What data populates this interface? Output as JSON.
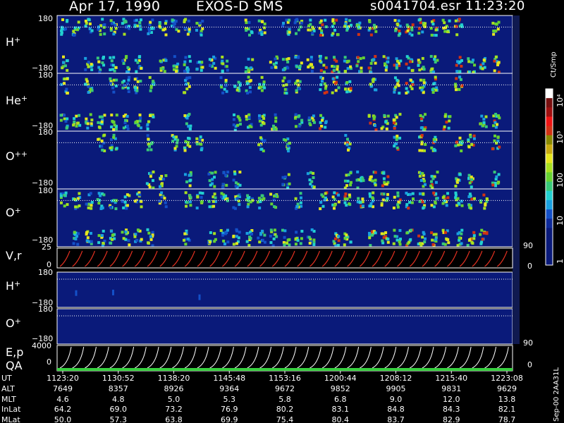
{
  "header": {
    "date": "Apr 17, 1990",
    "instrument": "EXOS-D SMS",
    "filename": "s0041704.esr",
    "time": "11:23:20"
  },
  "panels": [
    {
      "key": "h",
      "label": "H",
      "sup": "+",
      "ymax": "180",
      "ymin": "−180"
    },
    {
      "key": "he",
      "label": "He",
      "sup": "+",
      "ymax": "180",
      "ymin": "−180"
    },
    {
      "key": "opp",
      "label": "O",
      "sup": "++",
      "ymax": "180",
      "ymin": "−180"
    },
    {
      "key": "op",
      "label": "O",
      "sup": "+",
      "ymax": "180",
      "ymin": "−180"
    },
    {
      "key": "vr",
      "label": "V,r",
      "ymax": "25",
      "ymin": "0",
      "right_max": "90",
      "right_min": "0"
    },
    {
      "key": "h2",
      "label": "H",
      "sup": "+",
      "ymax": "180",
      "ymin": "−180"
    },
    {
      "key": "o2",
      "label": "O",
      "sup": "+",
      "ymax": "180",
      "ymin": "−180"
    },
    {
      "key": "ep",
      "label": "E,p",
      "label2": "QA",
      "ymax": "4000",
      "ymin": "0",
      "right_max": "90",
      "right_min": "0"
    }
  ],
  "colorbar": {
    "unit": "Ct/Smp",
    "ticks": [
      "1",
      "10",
      "100",
      "10³",
      "10⁴"
    ],
    "colors": [
      "#0a1a7a",
      "#0a1a7a",
      "#0a1a7a",
      "#0a1a7a",
      "#0e2a9a",
      "#1450c8",
      "#19a0e0",
      "#22d0d0",
      "#38c878",
      "#66d232",
      "#a8e020",
      "#e6e61e",
      "#c8aa10",
      "#8a8a00",
      "#d23214",
      "#f01414",
      "#a01010",
      "#781010",
      "#ffffff"
    ]
  },
  "axis_rows": {
    "labels": [
      "UT",
      "ALT",
      "MLT",
      "InLat",
      "MLat"
    ],
    "UT": [
      "1123:20",
      "1130:52",
      "1138:20",
      "1145:48",
      "1153:16",
      "1200:44",
      "1208:12",
      "1215:40",
      "1223:08"
    ],
    "ALT": [
      "7649",
      "8357",
      "8926",
      "9364",
      "9672",
      "9852",
      "9905",
      "9831",
      "9629"
    ],
    "MLT": [
      "4.6",
      "4.8",
      "5.0",
      "5.3",
      "5.8",
      "6.8",
      "9.0",
      "12.0",
      "13.8"
    ],
    "InLat": [
      "64.2",
      "69.0",
      "73.2",
      "76.9",
      "80.2",
      "83.1",
      "84.8",
      "84.3",
      "82.1"
    ],
    "MLat": [
      "50.0",
      "57.3",
      "63.8",
      "69.9",
      "75.4",
      "80.4",
      "83.7",
      "82.9",
      "78.7"
    ]
  },
  "side_note": "Sep-00  2AA31L",
  "chart_data": {
    "type": "heatmap",
    "title": "Apr 17, 1990   EXOS-D SMS",
    "xlabel": "UT",
    "x_ticks": [
      "1123:20",
      "1130:52",
      "1138:20",
      "1145:48",
      "1153:16",
      "1200:44",
      "1208:12",
      "1215:40",
      "1223:08"
    ],
    "panels": [
      "H+",
      "He+",
      "O++",
      "O+",
      "V,r",
      "H+",
      "O+",
      "E,p / QA"
    ],
    "pitch_angle_range": [
      -180,
      180
    ],
    "colorbar_unit": "Ct/Smp",
    "colorbar_scale": "log",
    "colorbar_range": [
      1,
      10000
    ],
    "vr_range": [
      0,
      25
    ],
    "ep_range": [
      0,
      4000
    ],
    "right_axis_range": [
      0,
      90
    ]
  }
}
